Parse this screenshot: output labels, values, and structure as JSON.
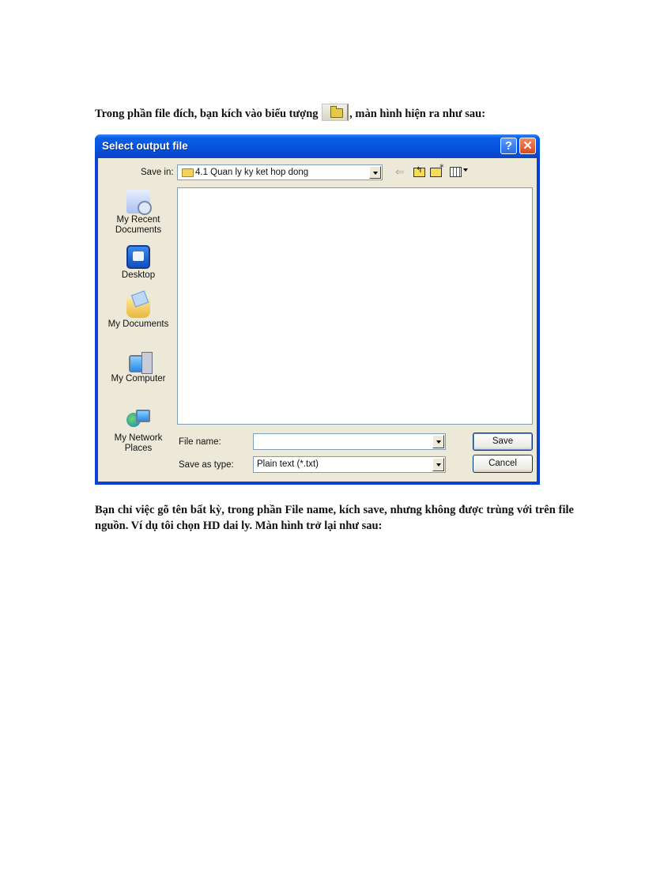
{
  "document": {
    "paragraph1_before": "Trong phần file đích, bạn kích vào biểu tượng",
    "paragraph1_after": ", màn hình  hiện ra như sau:",
    "inline_icon": "open-folder-icon",
    "paragraph2": "Bạn chỉ việc gõ tên bất kỳ, trong phần  File name,  kích  save, nhưng không được trùng  với trên file nguồn.  Ví dụ tôi chọn HD dai ly.  Màn hình  trở lại như sau:"
  },
  "dialog": {
    "title": "Select output file",
    "help_button": "?",
    "close_button": "✕",
    "save_in_label": "Save in:",
    "save_in_value": "4.1  Quan ly ky ket hop dong",
    "toolbar_icons": [
      "back-icon",
      "up-folder-icon",
      "new-folder-icon",
      "view-menu-icon"
    ],
    "places": [
      {
        "label_line1": "My Recent",
        "label_line2": "Documents",
        "icon": "recent-documents-icon"
      },
      {
        "label_line1": "Desktop",
        "label_line2": "",
        "icon": "desktop-icon"
      },
      {
        "label_line1": "My Documents",
        "label_line2": "",
        "icon": "my-documents-icon"
      },
      {
        "label_line1": "My Computer",
        "label_line2": "",
        "icon": "my-computer-icon"
      },
      {
        "label_line1": "My Network",
        "label_line2": "Places",
        "icon": "network-places-icon"
      }
    ],
    "file_name_label": "File name:",
    "file_name_value": "",
    "save_as_type_label": "Save as type:",
    "save_as_type_value": "Plain text (*.txt)",
    "save_button": "Save",
    "cancel_button": "Cancel"
  }
}
